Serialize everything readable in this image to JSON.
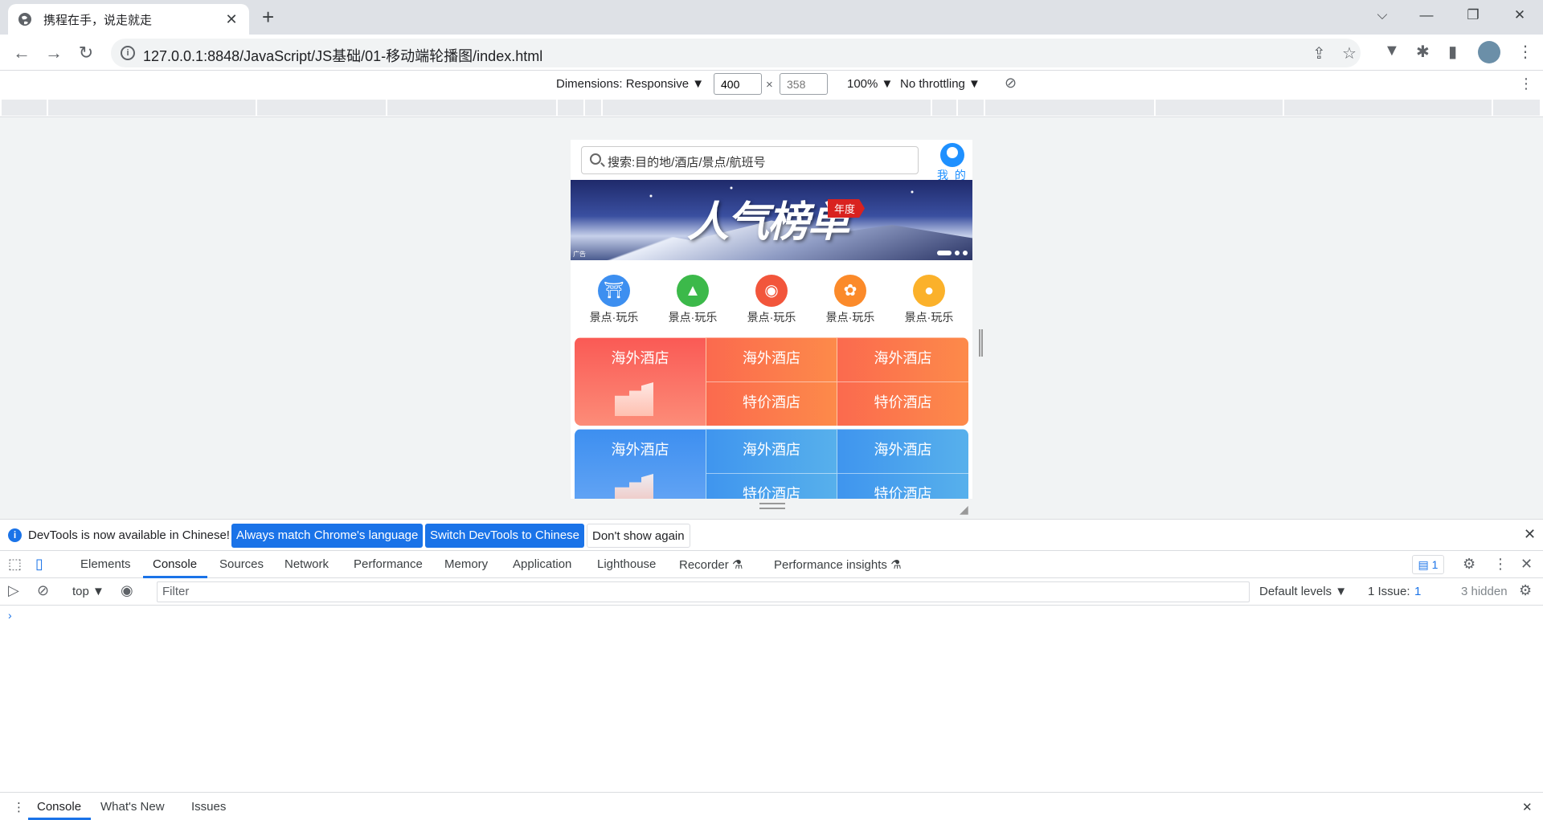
{
  "browser": {
    "tab_title": "携程在手，说走就走",
    "tab_close": "✕",
    "new_tab": "+",
    "url": "127.0.0.1:8848/JavaScript/JS基础/01-移动端轮播图/index.html",
    "window_controls": {
      "dropdown": "⌵",
      "minimize": "—",
      "restore": "❐",
      "close": "✕"
    }
  },
  "emulation": {
    "dimensions_label": "Dimensions: Responsive ▼",
    "width": "400",
    "height_placeholder": "358",
    "times": "×",
    "zoom": "100% ▼",
    "throttling": "No throttling ▼"
  },
  "page": {
    "search_placeholder": "搜索:目的地/酒店/景点/航班号",
    "mine_label": "我 的",
    "banner": {
      "title": "人气榜单",
      "tag": "年度",
      "ad": "广告"
    },
    "icons": [
      {
        "label": "景点·玩乐",
        "icon": "temple-icon",
        "color": "#3d8ff0",
        "glyph": "⛩"
      },
      {
        "label": "景点·玩乐",
        "icon": "mountain-icon",
        "color": "#3cb94a",
        "glyph": "▲"
      },
      {
        "label": "景点·玩乐",
        "icon": "compass-icon",
        "color": "#f2553b",
        "glyph": "◉"
      },
      {
        "label": "景点·玩乐",
        "icon": "flower-icon",
        "color": "#fb8a2a",
        "glyph": "✿"
      },
      {
        "label": "景点·玩乐",
        "icon": "person-pin-icon",
        "color": "#fbb12a",
        "glyph": "●"
      }
    ],
    "grid1": {
      "big": "海外酒店",
      "cells": [
        "海外酒店",
        "海外酒店",
        "特价酒店",
        "特价酒店"
      ]
    },
    "grid2": {
      "big": "海外酒店",
      "cells": [
        "海外酒店",
        "海外酒店",
        "特价酒店",
        "特价酒店"
      ]
    }
  },
  "infobar": {
    "message": "DevTools is now available in Chinese!",
    "btn_match": "Always match Chrome's language",
    "btn_switch": "Switch DevTools to Chinese",
    "btn_dismiss": "Don't show again"
  },
  "devtools": {
    "tabs": [
      "Elements",
      "Console",
      "Sources",
      "Network",
      "Performance",
      "Memory",
      "Application",
      "Lighthouse",
      "Recorder ⚗",
      "Performance insights ⚗"
    ],
    "message_count": "1",
    "context": "top ▼",
    "filter_placeholder": "Filter",
    "levels": "Default levels ▼",
    "issues": "1 Issue:",
    "issues_count": "1",
    "hidden": "3 hidden",
    "prompt": "›",
    "drawer_tabs": [
      "Console",
      "What's New",
      "Issues"
    ]
  }
}
